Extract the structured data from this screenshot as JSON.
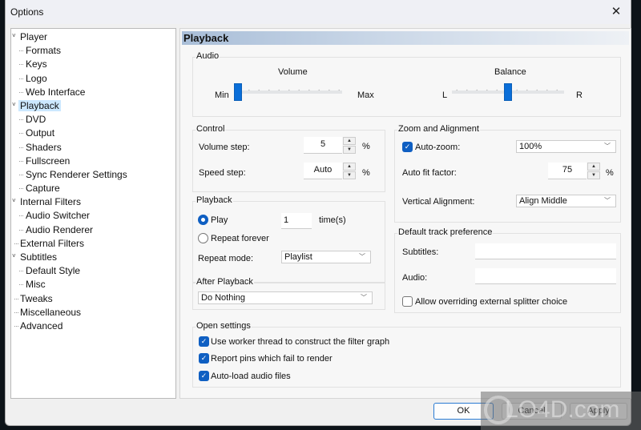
{
  "window": {
    "title": "Options",
    "close_label": "✕"
  },
  "tree": [
    {
      "label": "Player",
      "level": 0,
      "expanded": true
    },
    {
      "label": "Formats",
      "level": 1
    },
    {
      "label": "Keys",
      "level": 1
    },
    {
      "label": "Logo",
      "level": 1
    },
    {
      "label": "Web Interface",
      "level": 1
    },
    {
      "label": "Playback",
      "level": 0,
      "expanded": true,
      "selected": true
    },
    {
      "label": "DVD",
      "level": 1
    },
    {
      "label": "Output",
      "level": 1
    },
    {
      "label": "Shaders",
      "level": 1
    },
    {
      "label": "Fullscreen",
      "level": 1
    },
    {
      "label": "Sync Renderer Settings",
      "level": 1
    },
    {
      "label": "Capture",
      "level": 1
    },
    {
      "label": "Internal Filters",
      "level": 0,
      "expanded": true
    },
    {
      "label": "Audio Switcher",
      "level": 1
    },
    {
      "label": "Audio Renderer",
      "level": 1
    },
    {
      "label": "External Filters",
      "level": 0
    },
    {
      "label": "Subtitles",
      "level": 0,
      "expanded": true
    },
    {
      "label": "Default Style",
      "level": 1
    },
    {
      "label": "Misc",
      "level": 1
    },
    {
      "label": "Tweaks",
      "level": 0
    },
    {
      "label": "Miscellaneous",
      "level": 0
    },
    {
      "label": "Advanced",
      "level": 0
    }
  ],
  "page": {
    "title": "Playback",
    "audio": {
      "title": "Audio",
      "volume": {
        "label": "Volume",
        "min_label": "Min",
        "max_label": "Max",
        "value_fraction": 0.0
      },
      "balance": {
        "label": "Balance",
        "min_label": "L",
        "max_label": "R",
        "value_fraction": 0.5
      }
    },
    "control": {
      "title": "Control",
      "volume_step_label": "Volume step:",
      "volume_step_value": "5",
      "volume_step_unit": "%",
      "speed_step_label": "Speed step:",
      "speed_step_value": "Auto",
      "speed_step_unit": "%"
    },
    "zoom": {
      "title": "Zoom and Alignment",
      "auto_zoom_label": "Auto-zoom:",
      "auto_zoom_checked": true,
      "auto_zoom_value": "100%",
      "auto_fit_label": "Auto fit factor:",
      "auto_fit_value": "75",
      "auto_fit_unit": "%",
      "valign_label": "Vertical Alignment:",
      "valign_value": "Align Middle"
    },
    "playback": {
      "title": "Playback",
      "play_label": "Play",
      "play_selected": true,
      "play_times": "1",
      "times_label": "time(s)",
      "repeat_forever_label": "Repeat forever",
      "repeat_mode_label": "Repeat mode:",
      "repeat_mode_value": "Playlist"
    },
    "track": {
      "title": "Default track preference",
      "subtitles_label": "Subtitles:",
      "subtitles_value": "",
      "audio_label": "Audio:",
      "audio_value": "",
      "allow_override_label": "Allow overriding external splitter choice",
      "allow_override_checked": false
    },
    "after": {
      "title": "After Playback",
      "value": "Do Nothing"
    },
    "open": {
      "title": "Open settings",
      "items": [
        {
          "label": "Use worker thread to construct the filter graph",
          "checked": true
        },
        {
          "label": "Report pins which fail to render",
          "checked": true
        },
        {
          "label": "Auto-load audio files",
          "checked": true
        }
      ]
    }
  },
  "buttons": {
    "ok": "OK",
    "cancel": "Cancel",
    "apply": "Apply"
  },
  "watermark": "LO4D.com",
  "icons": {
    "checkmark": "✓",
    "chevron_down": "﹀",
    "arrow_up": "▲",
    "arrow_down": "▼",
    "tree_expanded": "˅"
  }
}
